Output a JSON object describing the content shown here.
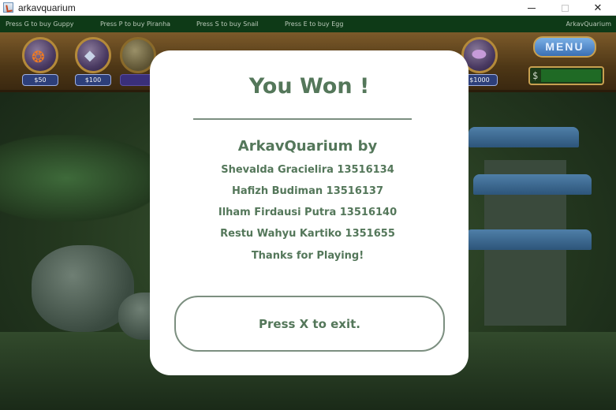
{
  "window": {
    "title": "arkavquarium",
    "minimize_glyph": "—",
    "close_glyph": "✕"
  },
  "hints": {
    "guppy": "Press G to buy Guppy",
    "piranha": "Press P to buy Piranha",
    "snail": "Press S to buy Snail",
    "egg": "Press E to buy Egg",
    "brand": "ArkavQuarium"
  },
  "shop": {
    "guppy_price": "$50",
    "piranha_price": "$100",
    "egg_price": "$1000",
    "menu_label": "MENU",
    "money_prefix": "$"
  },
  "modal": {
    "title": "You Won !",
    "credit_title": "ArkavQuarium by",
    "credits": [
      "Shevalda Gracielira 13516134",
      "Hafizh Budiman 13516137",
      "Ilham Firdausi Putra 13516140",
      "Restu Wahyu Kartiko 1351655",
      "Thanks for Playing!"
    ],
    "exit_label": "Press X to exit."
  },
  "colors": {
    "accent": "#54775a",
    "hint_bar": "#0e3a17"
  },
  "icons": {
    "app": "java-app-icon",
    "guppy": "guppy-fish-icon",
    "piranha": "piranha-fish-icon",
    "egg": "egg-icon"
  }
}
